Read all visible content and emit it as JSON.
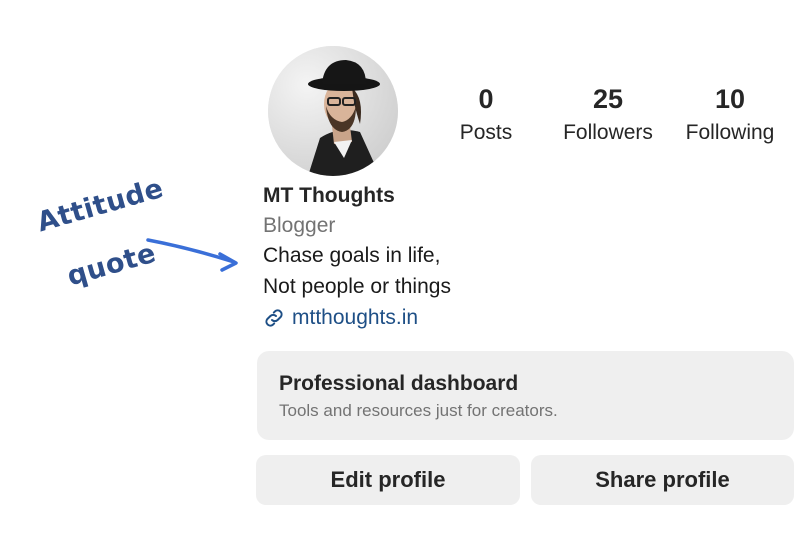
{
  "profile": {
    "name": "MT Thoughts",
    "category": "Blogger",
    "bio_lines": [
      "Chase goals in life,",
      "Not people or things"
    ],
    "link": "mtthoughts.in",
    "link_icon": "link-icon",
    "avatar_icon": "avatar"
  },
  "stats": [
    {
      "value": "0",
      "label": "Posts"
    },
    {
      "value": "25",
      "label": "Followers"
    },
    {
      "value": "10",
      "label": "Following"
    }
  ],
  "dashboard": {
    "title": "Professional dashboard",
    "subtitle": "Tools and resources just for creators."
  },
  "buttons": {
    "edit": "Edit profile",
    "share": "Share profile"
  },
  "annotation": {
    "lines": [
      "Attitude",
      "quote"
    ],
    "color": "#2f4f8a",
    "arrow_color": "#3a6fd8"
  },
  "colors": {
    "link": "#1e4f86",
    "muted": "#737373",
    "card_bg": "#efefef"
  }
}
